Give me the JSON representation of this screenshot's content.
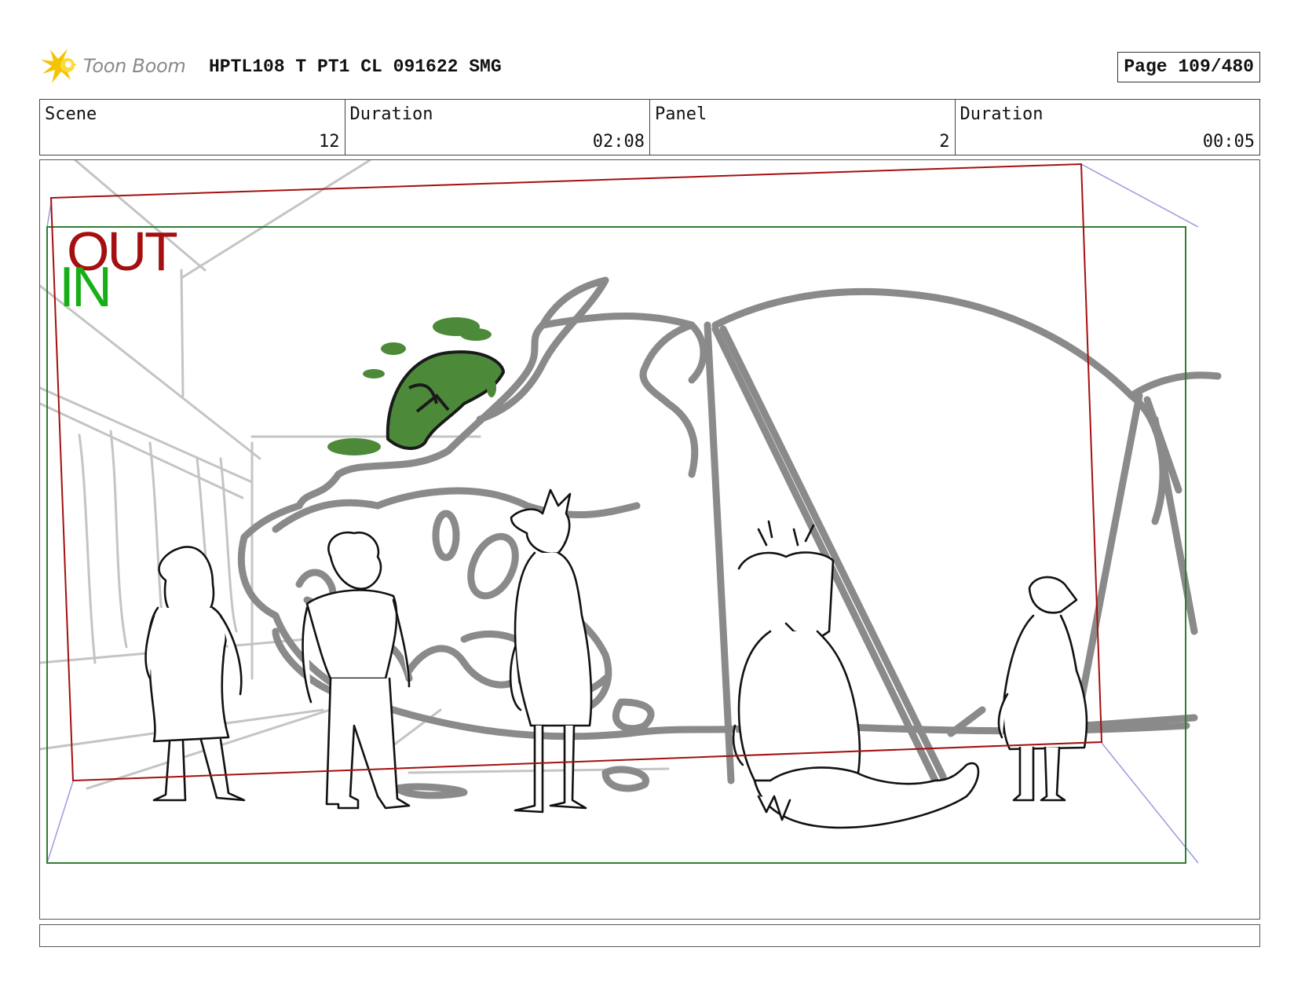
{
  "header": {
    "logo_text": "Toon Boom",
    "title": "HPTL108 T PT1 CL 091622 SMG",
    "page": "Page 109/480"
  },
  "info": {
    "scene_label": "Scene",
    "scene_value": "12",
    "scene_duration_label": "Duration",
    "scene_duration_value": "02:08",
    "panel_label": "Panel",
    "panel_value": "2",
    "panel_duration_label": "Duration",
    "panel_duration_value": "00:05"
  },
  "frame": {
    "out_label": "OUT",
    "in_label": "IN",
    "out_color": "#a40f0f",
    "in_color": "#16b016"
  },
  "colors": {
    "logo_accent": "#f5c400",
    "sketch_grey": "#8a8a8a",
    "ink": "#111111",
    "fill_green": "#4c8a3a"
  },
  "notes": ""
}
